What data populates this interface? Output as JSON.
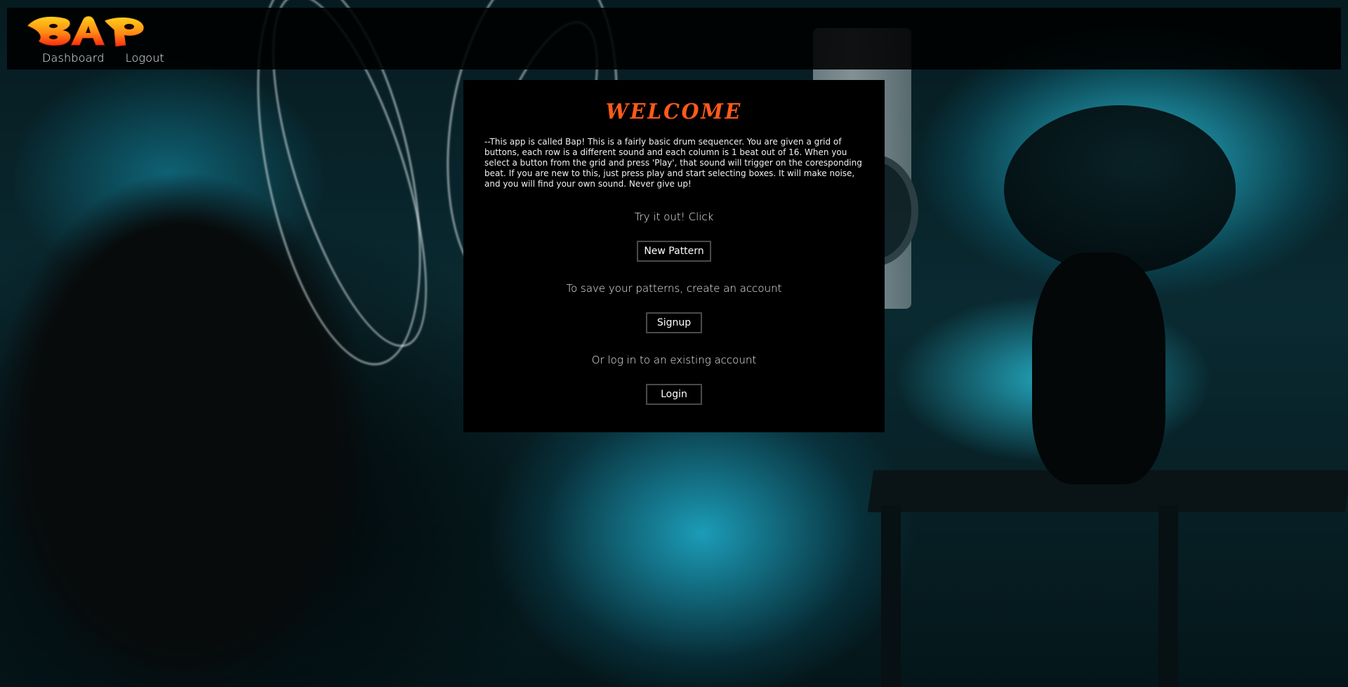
{
  "app": {
    "logo_text": "BAP"
  },
  "nav": {
    "links": [
      {
        "label": "Dashboard"
      },
      {
        "label": "Logout"
      }
    ]
  },
  "welcome": {
    "title": "WELCOME",
    "description": "--This app is called Bap! This is a fairly basic drum sequencer. You are given a grid of buttons, each row is a different sound and each column is 1 beat out of 16. When you select a button from the grid and press 'Play', that sound will trigger on the coresponding beat. If you are new to this, just press play and start selecting boxes. It will make noise, and you will find your own sound. Never give up!",
    "try_text": "Try it out! Click",
    "new_pattern_label": "New Pattern",
    "save_text": "To save your patterns, create an account",
    "signup_label": "Signup",
    "login_text": "Or log in to an existing account",
    "login_label": "Login"
  },
  "colors": {
    "accent": "#ff5a1a",
    "logo_top": "#ffd21a",
    "logo_bottom": "#ff2a10",
    "card_bg": "#000000",
    "button_border": "#4a4a4a"
  }
}
